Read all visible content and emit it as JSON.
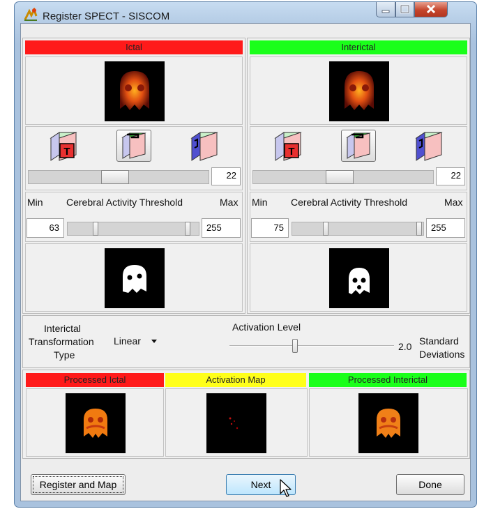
{
  "window": {
    "title": "Register SPECT - SISCOM"
  },
  "ictal": {
    "header": "Ictal",
    "slice_value": "22",
    "threshold": {
      "min_label": "Min",
      "title": "Cerebral Activity Threshold",
      "max_label": "Max",
      "min_value": "63",
      "max_value": "255"
    }
  },
  "interictal": {
    "header": "Interictal",
    "slice_value": "22",
    "threshold": {
      "min_label": "Min",
      "title": "Cerebral Activity Threshold",
      "max_label": "Max",
      "min_value": "75",
      "max_value": "255"
    }
  },
  "view_icons": [
    "view-t-icon",
    "view-c-icon",
    "view-s-icon"
  ],
  "transform": {
    "label_lines": [
      "Interictal",
      "Transformation",
      "Type"
    ],
    "value": "Linear"
  },
  "activation": {
    "label": "Activation Level",
    "value": "2.0",
    "unit_lines": [
      "Standard",
      "Deviations"
    ]
  },
  "results": {
    "processed_ictal": "Processed Ictal",
    "activation_map": "Activation Map",
    "processed_interictal": "Processed Interictal"
  },
  "buttons": {
    "register": "Register and Map",
    "next": "Next",
    "done": "Done"
  },
  "colors": {
    "ictal_header": "#ff1a1a",
    "interictal_header": "#1aff1a",
    "activation_header": "#ffff1a"
  }
}
